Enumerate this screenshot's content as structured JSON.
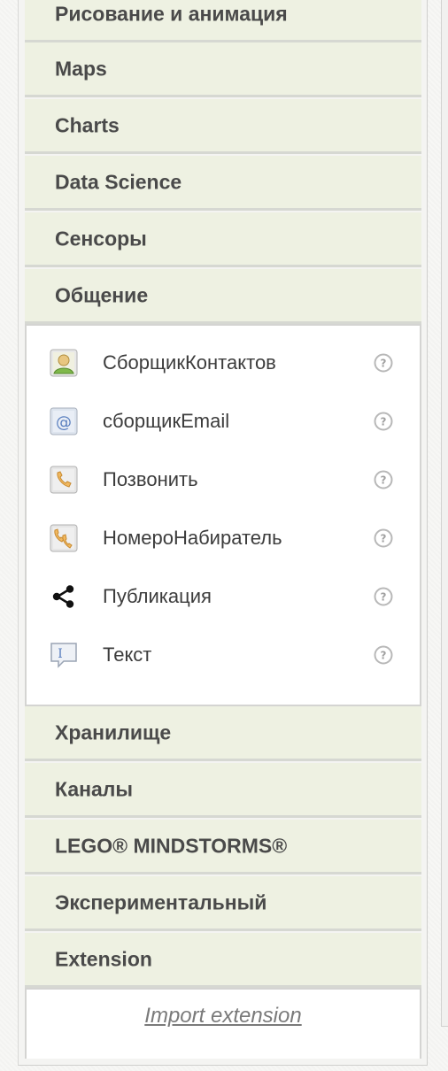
{
  "palette": {
    "drawer_bg": "#eef1e2",
    "label_color": "#4a4a4a",
    "link_color": "#7a7a7a"
  },
  "categories_top": [
    {
      "label": "Рисование и анимация"
    },
    {
      "label": "Maps"
    },
    {
      "label": "Charts"
    },
    {
      "label": "Data Science"
    },
    {
      "label": "Сенсоры"
    },
    {
      "label": "Общение"
    }
  ],
  "open_drawer": {
    "components": [
      {
        "label": "СборщикКонтактов",
        "icon": "contact-picker-icon"
      },
      {
        "label": "сборщикEmail",
        "icon": "email-picker-icon"
      },
      {
        "label": "Позвонить",
        "icon": "phone-call-icon"
      },
      {
        "label": "НомероНабиратель",
        "icon": "phone-number-picker-icon"
      },
      {
        "label": "Публикация",
        "icon": "share-icon"
      },
      {
        "label": "Текст",
        "icon": "texting-icon"
      }
    ]
  },
  "categories_bottom": [
    {
      "label": "Хранилище"
    },
    {
      "label": "Каналы"
    },
    {
      "label": "LEGO® MINDSTORMS®"
    },
    {
      "label": "Экспериментальный"
    },
    {
      "label": "Extension"
    }
  ],
  "extension": {
    "import_label": "Import extension"
  }
}
